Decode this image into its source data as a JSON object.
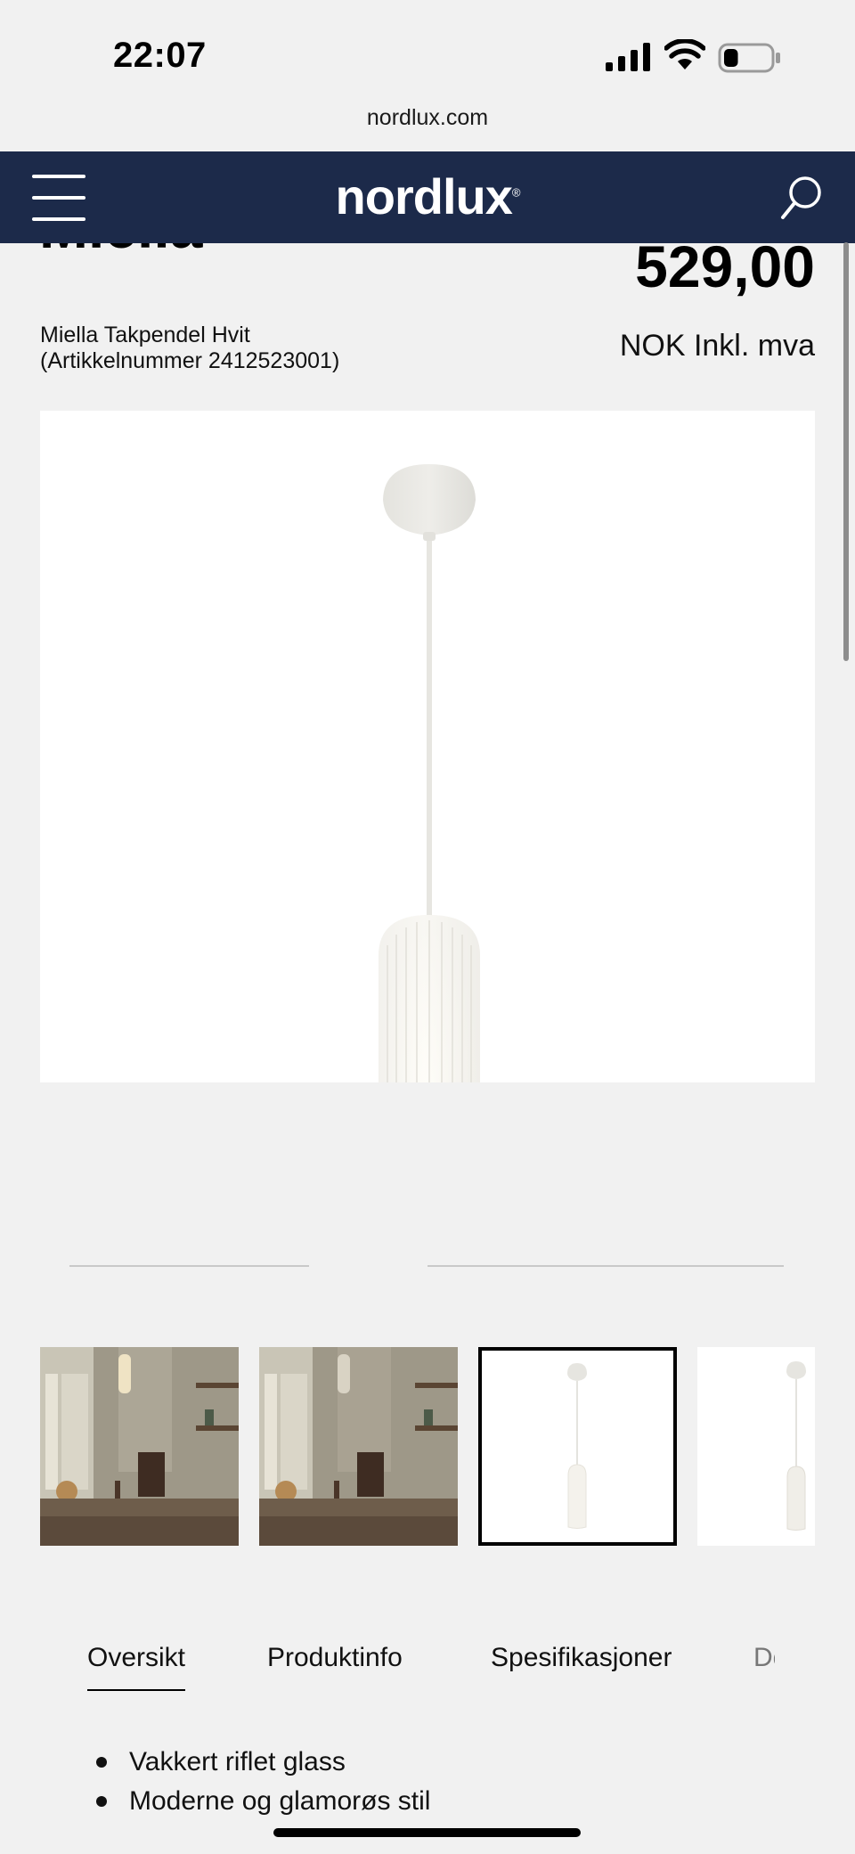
{
  "status_bar": {
    "time": "22:07",
    "battery_level": 0.25
  },
  "browser": {
    "url": "nordlux.com"
  },
  "header": {
    "logo": "nordlux",
    "logo_mark": "®"
  },
  "product": {
    "name": "Miella",
    "price": "529,00",
    "currency": "NOK Inkl. mva",
    "subtitle_line1": "Miella Takpendel Hvit",
    "subtitle_line2": "(Artikkelnummer 2412523001)"
  },
  "gallery": {
    "thumbnail_count": 4,
    "selected_index": 2
  },
  "tabs": [
    {
      "label": "Oversikt",
      "active": true
    },
    {
      "label": "Produktinfo",
      "active": false
    },
    {
      "label": "Spesifikasjoner",
      "active": false
    },
    {
      "label": "Dokumenter",
      "active": false
    }
  ],
  "features": [
    "Vakkert riflet glass",
    "Moderne og glamorøs stil"
  ]
}
